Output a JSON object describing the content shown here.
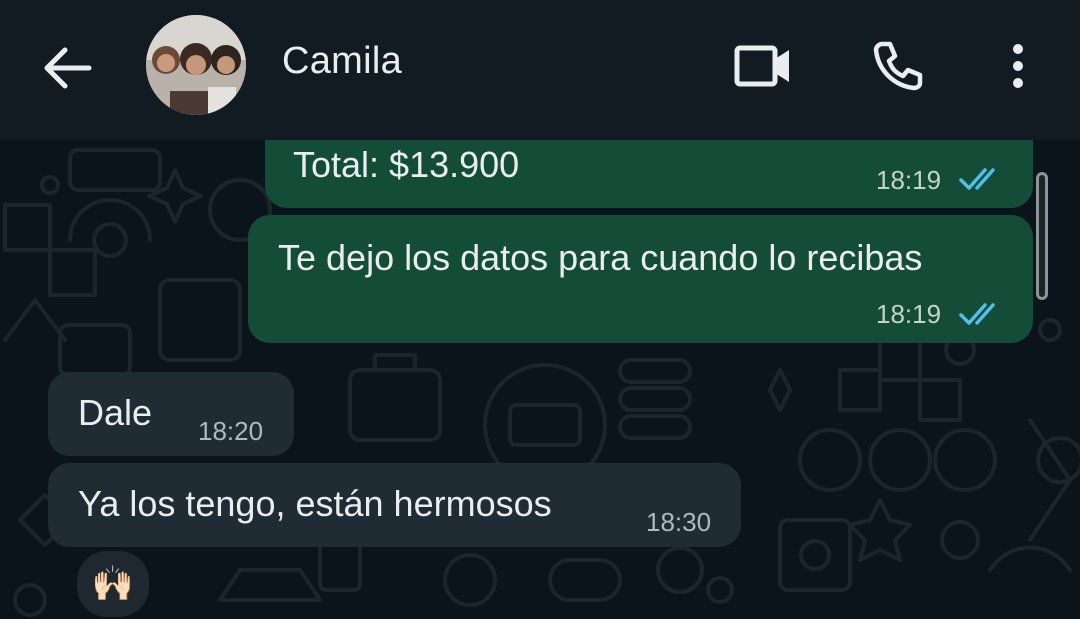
{
  "header": {
    "contact_name": "Camila",
    "back_icon": "arrow-left-icon",
    "video_icon": "video-camera-icon",
    "call_icon": "phone-icon",
    "menu_icon": "more-vertical-icon"
  },
  "messages": [
    {
      "direction": "outgoing",
      "text": "Total: $13.900",
      "time": "18:19",
      "status": "read"
    },
    {
      "direction": "outgoing",
      "text": "Te dejo los datos para cuando lo recibas",
      "time": "18:19",
      "status": "read"
    },
    {
      "direction": "incoming",
      "text": "Dale",
      "time": "18:20"
    },
    {
      "direction": "incoming",
      "text": "Ya los tengo, están hermosos",
      "time": "18:30",
      "reaction": "🙌🏻"
    }
  ],
  "colors": {
    "header_bg": "#111b21",
    "chat_bg": "#0b141a",
    "outgoing_bubble": "#144d37",
    "incoming_bubble": "#202c33",
    "read_tick": "#53bdeb"
  }
}
